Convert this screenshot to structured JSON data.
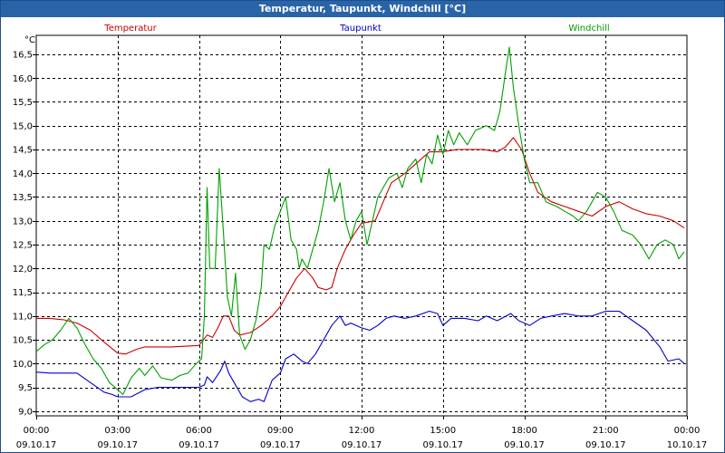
{
  "window": {
    "title": "Temperatur, Taupunkt, Windchill [°C]"
  },
  "colors": {
    "temperatur": "#cc0000",
    "taupunkt": "#0000cc",
    "windchill": "#00a000",
    "grid": "#000000",
    "titlebar": "#2a64a8"
  },
  "chart_data": {
    "type": "line",
    "ylabel": "°C",
    "ylim": [
      8.9,
      16.9
    ],
    "yticks": [
      {
        "v": 9.0,
        "label": "9,0"
      },
      {
        "v": 9.5,
        "label": "9,5"
      },
      {
        "v": 10.0,
        "label": "10,0"
      },
      {
        "v": 10.5,
        "label": "10,5"
      },
      {
        "v": 11.0,
        "label": "11,0"
      },
      {
        "v": 11.5,
        "label": "11,5"
      },
      {
        "v": 12.0,
        "label": "12,0"
      },
      {
        "v": 12.5,
        "label": "12,5"
      },
      {
        "v": 13.0,
        "label": "13,0"
      },
      {
        "v": 13.5,
        "label": "13,5"
      },
      {
        "v": 14.0,
        "label": "14,0"
      },
      {
        "v": 14.5,
        "label": "14,5"
      },
      {
        "v": 15.0,
        "label": "15,0"
      },
      {
        "v": 15.5,
        "label": "15,5"
      },
      {
        "v": 16.0,
        "label": "16,0"
      },
      {
        "v": 16.5,
        "label": "16,5"
      }
    ],
    "xlim": [
      0,
      24
    ],
    "xticks": [
      {
        "h": 0,
        "time": "00:00",
        "date": "09.10.17"
      },
      {
        "h": 3,
        "time": "03:00",
        "date": "09.10.17"
      },
      {
        "h": 6,
        "time": "06:00",
        "date": "09.10.17"
      },
      {
        "h": 9,
        "time": "09:00",
        "date": "09.10.17"
      },
      {
        "h": 12,
        "time": "12:00",
        "date": "09.10.17"
      },
      {
        "h": 15,
        "time": "15:00",
        "date": "09.10.17"
      },
      {
        "h": 18,
        "time": "18:00",
        "date": "09.10.17"
      },
      {
        "h": 21,
        "time": "21:00",
        "date": "09.10.17"
      },
      {
        "h": 24,
        "time": "00:00",
        "date": "10.10.17"
      }
    ],
    "grid": true,
    "legend_placement": "top",
    "series": [
      {
        "name": "Temperatur",
        "color": "#cc0000",
        "points": [
          [
            0,
            10.95
          ],
          [
            0.5,
            10.95
          ],
          [
            1,
            10.92
          ],
          [
            1.5,
            10.85
          ],
          [
            2,
            10.7
          ],
          [
            2.5,
            10.45
          ],
          [
            3,
            10.22
          ],
          [
            3.3,
            10.2
          ],
          [
            3.7,
            10.3
          ],
          [
            4,
            10.35
          ],
          [
            5,
            10.35
          ],
          [
            6,
            10.38
          ],
          [
            6.1,
            10.45
          ],
          [
            6.3,
            10.6
          ],
          [
            6.5,
            10.55
          ],
          [
            6.7,
            10.75
          ],
          [
            6.9,
            11.0
          ],
          [
            7.1,
            11.0
          ],
          [
            7.3,
            10.7
          ],
          [
            7.5,
            10.6
          ],
          [
            7.9,
            10.65
          ],
          [
            8.3,
            10.8
          ],
          [
            8.7,
            11.0
          ],
          [
            9.0,
            11.2
          ],
          [
            9.3,
            11.5
          ],
          [
            9.6,
            11.8
          ],
          [
            9.9,
            12.0
          ],
          [
            10.2,
            11.8
          ],
          [
            10.4,
            11.6
          ],
          [
            10.7,
            11.55
          ],
          [
            10.9,
            11.6
          ],
          [
            11.1,
            12.0
          ],
          [
            11.4,
            12.4
          ],
          [
            11.7,
            12.7
          ],
          [
            12.0,
            12.95
          ],
          [
            12.5,
            13.0
          ],
          [
            12.8,
            13.4
          ],
          [
            13.1,
            13.8
          ],
          [
            13.6,
            14.0
          ],
          [
            14.0,
            14.2
          ],
          [
            14.5,
            14.45
          ],
          [
            15.0,
            14.45
          ],
          [
            15.5,
            14.5
          ],
          [
            16.0,
            14.5
          ],
          [
            16.5,
            14.5
          ],
          [
            17.0,
            14.45
          ],
          [
            17.3,
            14.55
          ],
          [
            17.6,
            14.75
          ],
          [
            17.9,
            14.5
          ],
          [
            18.2,
            14.0
          ],
          [
            18.5,
            13.6
          ],
          [
            19.0,
            13.4
          ],
          [
            19.5,
            13.3
          ],
          [
            20.0,
            13.2
          ],
          [
            20.5,
            13.1
          ],
          [
            21.0,
            13.3
          ],
          [
            21.5,
            13.4
          ],
          [
            22.0,
            13.25
          ],
          [
            22.5,
            13.15
          ],
          [
            23.0,
            13.1
          ],
          [
            23.5,
            13.0
          ],
          [
            23.9,
            12.85
          ]
        ]
      },
      {
        "name": "Taupunkt",
        "color": "#0000cc",
        "points": [
          [
            0,
            9.82
          ],
          [
            0.5,
            9.8
          ],
          [
            1.5,
            9.8
          ],
          [
            2.0,
            9.6
          ],
          [
            2.5,
            9.4
          ],
          [
            2.8,
            9.35
          ],
          [
            3.0,
            9.3
          ],
          [
            3.5,
            9.3
          ],
          [
            4.0,
            9.45
          ],
          [
            4.5,
            9.5
          ],
          [
            5.0,
            9.5
          ],
          [
            6.0,
            9.5
          ],
          [
            6.2,
            9.55
          ],
          [
            6.3,
            9.72
          ],
          [
            6.5,
            9.6
          ],
          [
            6.8,
            9.85
          ],
          [
            6.95,
            10.05
          ],
          [
            7.1,
            9.8
          ],
          [
            7.3,
            9.6
          ],
          [
            7.6,
            9.3
          ],
          [
            7.9,
            9.2
          ],
          [
            8.2,
            9.25
          ],
          [
            8.4,
            9.2
          ],
          [
            8.7,
            9.65
          ],
          [
            9.0,
            9.8
          ],
          [
            9.2,
            10.1
          ],
          [
            9.5,
            10.2
          ],
          [
            9.8,
            10.05
          ],
          [
            10.0,
            10.0
          ],
          [
            10.3,
            10.2
          ],
          [
            10.6,
            10.5
          ],
          [
            10.9,
            10.8
          ],
          [
            11.2,
            11.0
          ],
          [
            11.4,
            10.8
          ],
          [
            11.6,
            10.85
          ],
          [
            12.0,
            10.75
          ],
          [
            12.3,
            10.7
          ],
          [
            12.6,
            10.8
          ],
          [
            12.9,
            10.95
          ],
          [
            13.2,
            11.0
          ],
          [
            13.6,
            10.95
          ],
          [
            14.0,
            11.0
          ],
          [
            14.5,
            11.1
          ],
          [
            14.8,
            11.05
          ],
          [
            15.0,
            10.8
          ],
          [
            15.3,
            10.95
          ],
          [
            15.8,
            10.95
          ],
          [
            16.3,
            10.9
          ],
          [
            16.6,
            11.0
          ],
          [
            17.0,
            10.9
          ],
          [
            17.5,
            11.05
          ],
          [
            17.8,
            10.9
          ],
          [
            18.2,
            10.8
          ],
          [
            18.6,
            10.95
          ],
          [
            19.0,
            11.0
          ],
          [
            19.5,
            11.05
          ],
          [
            20.0,
            11.0
          ],
          [
            20.5,
            11.0
          ],
          [
            21.0,
            11.1
          ],
          [
            21.5,
            11.1
          ],
          [
            22.0,
            10.9
          ],
          [
            22.5,
            10.7
          ],
          [
            23.0,
            10.35
          ],
          [
            23.3,
            10.05
          ],
          [
            23.7,
            10.1
          ],
          [
            23.9,
            10.0
          ]
        ]
      },
      {
        "name": "Windchill",
        "color": "#00a000",
        "points": [
          [
            0,
            10.25
          ],
          [
            0.3,
            10.4
          ],
          [
            0.6,
            10.5
          ],
          [
            0.9,
            10.7
          ],
          [
            1.2,
            10.95
          ],
          [
            1.5,
            10.75
          ],
          [
            1.8,
            10.4
          ],
          [
            2.1,
            10.1
          ],
          [
            2.4,
            9.9
          ],
          [
            2.7,
            9.6
          ],
          [
            3.0,
            9.45
          ],
          [
            3.2,
            9.35
          ],
          [
            3.5,
            9.7
          ],
          [
            3.8,
            9.9
          ],
          [
            4.0,
            9.75
          ],
          [
            4.3,
            9.95
          ],
          [
            4.6,
            9.7
          ],
          [
            5.0,
            9.65
          ],
          [
            5.3,
            9.75
          ],
          [
            5.6,
            9.8
          ],
          [
            5.9,
            10.0
          ],
          [
            6.1,
            10.1
          ],
          [
            6.2,
            11.0
          ],
          [
            6.3,
            13.7
          ],
          [
            6.4,
            12.0
          ],
          [
            6.6,
            12.0
          ],
          [
            6.75,
            14.1
          ],
          [
            6.9,
            12.8
          ],
          [
            7.05,
            11.4
          ],
          [
            7.2,
            11.0
          ],
          [
            7.35,
            11.9
          ],
          [
            7.5,
            10.6
          ],
          [
            7.7,
            10.3
          ],
          [
            7.9,
            10.5
          ],
          [
            8.1,
            10.9
          ],
          [
            8.3,
            11.6
          ],
          [
            8.4,
            12.5
          ],
          [
            8.6,
            12.4
          ],
          [
            8.8,
            12.9
          ],
          [
            9.0,
            13.2
          ],
          [
            9.2,
            13.5
          ],
          [
            9.4,
            12.6
          ],
          [
            9.6,
            12.4
          ],
          [
            9.7,
            12.0
          ],
          [
            9.8,
            12.2
          ],
          [
            10.0,
            12.0
          ],
          [
            10.2,
            12.4
          ],
          [
            10.4,
            12.8
          ],
          [
            10.6,
            13.4
          ],
          [
            10.8,
            14.1
          ],
          [
            11.0,
            13.4
          ],
          [
            11.2,
            13.8
          ],
          [
            11.4,
            13.0
          ],
          [
            11.6,
            12.6
          ],
          [
            11.8,
            13.0
          ],
          [
            12.0,
            13.2
          ],
          [
            12.2,
            12.5
          ],
          [
            12.4,
            13.0
          ],
          [
            12.6,
            13.5
          ],
          [
            12.8,
            13.7
          ],
          [
            13.0,
            13.9
          ],
          [
            13.3,
            14.0
          ],
          [
            13.5,
            13.7
          ],
          [
            13.7,
            14.1
          ],
          [
            14.0,
            14.3
          ],
          [
            14.2,
            13.8
          ],
          [
            14.4,
            14.4
          ],
          [
            14.6,
            14.2
          ],
          [
            14.8,
            14.8
          ],
          [
            15.0,
            14.4
          ],
          [
            15.2,
            14.9
          ],
          [
            15.4,
            14.6
          ],
          [
            15.6,
            14.85
          ],
          [
            15.9,
            14.6
          ],
          [
            16.2,
            14.9
          ],
          [
            16.6,
            15.0
          ],
          [
            16.9,
            14.9
          ],
          [
            17.1,
            15.3
          ],
          [
            17.3,
            16.1
          ],
          [
            17.45,
            16.65
          ],
          [
            17.6,
            15.8
          ],
          [
            17.8,
            15.0
          ],
          [
            18.0,
            14.3
          ],
          [
            18.2,
            13.8
          ],
          [
            18.5,
            13.8
          ],
          [
            18.8,
            13.4
          ],
          [
            19.2,
            13.3
          ],
          [
            19.5,
            13.2
          ],
          [
            19.8,
            13.1
          ],
          [
            20.0,
            13.0
          ],
          [
            20.3,
            13.2
          ],
          [
            20.7,
            13.6
          ],
          [
            21.0,
            13.5
          ],
          [
            21.3,
            13.2
          ],
          [
            21.6,
            12.8
          ],
          [
            22.0,
            12.7
          ],
          [
            22.3,
            12.5
          ],
          [
            22.6,
            12.2
          ],
          [
            22.9,
            12.5
          ],
          [
            23.2,
            12.6
          ],
          [
            23.5,
            12.5
          ],
          [
            23.7,
            12.2
          ],
          [
            23.9,
            12.35
          ]
        ]
      }
    ]
  }
}
